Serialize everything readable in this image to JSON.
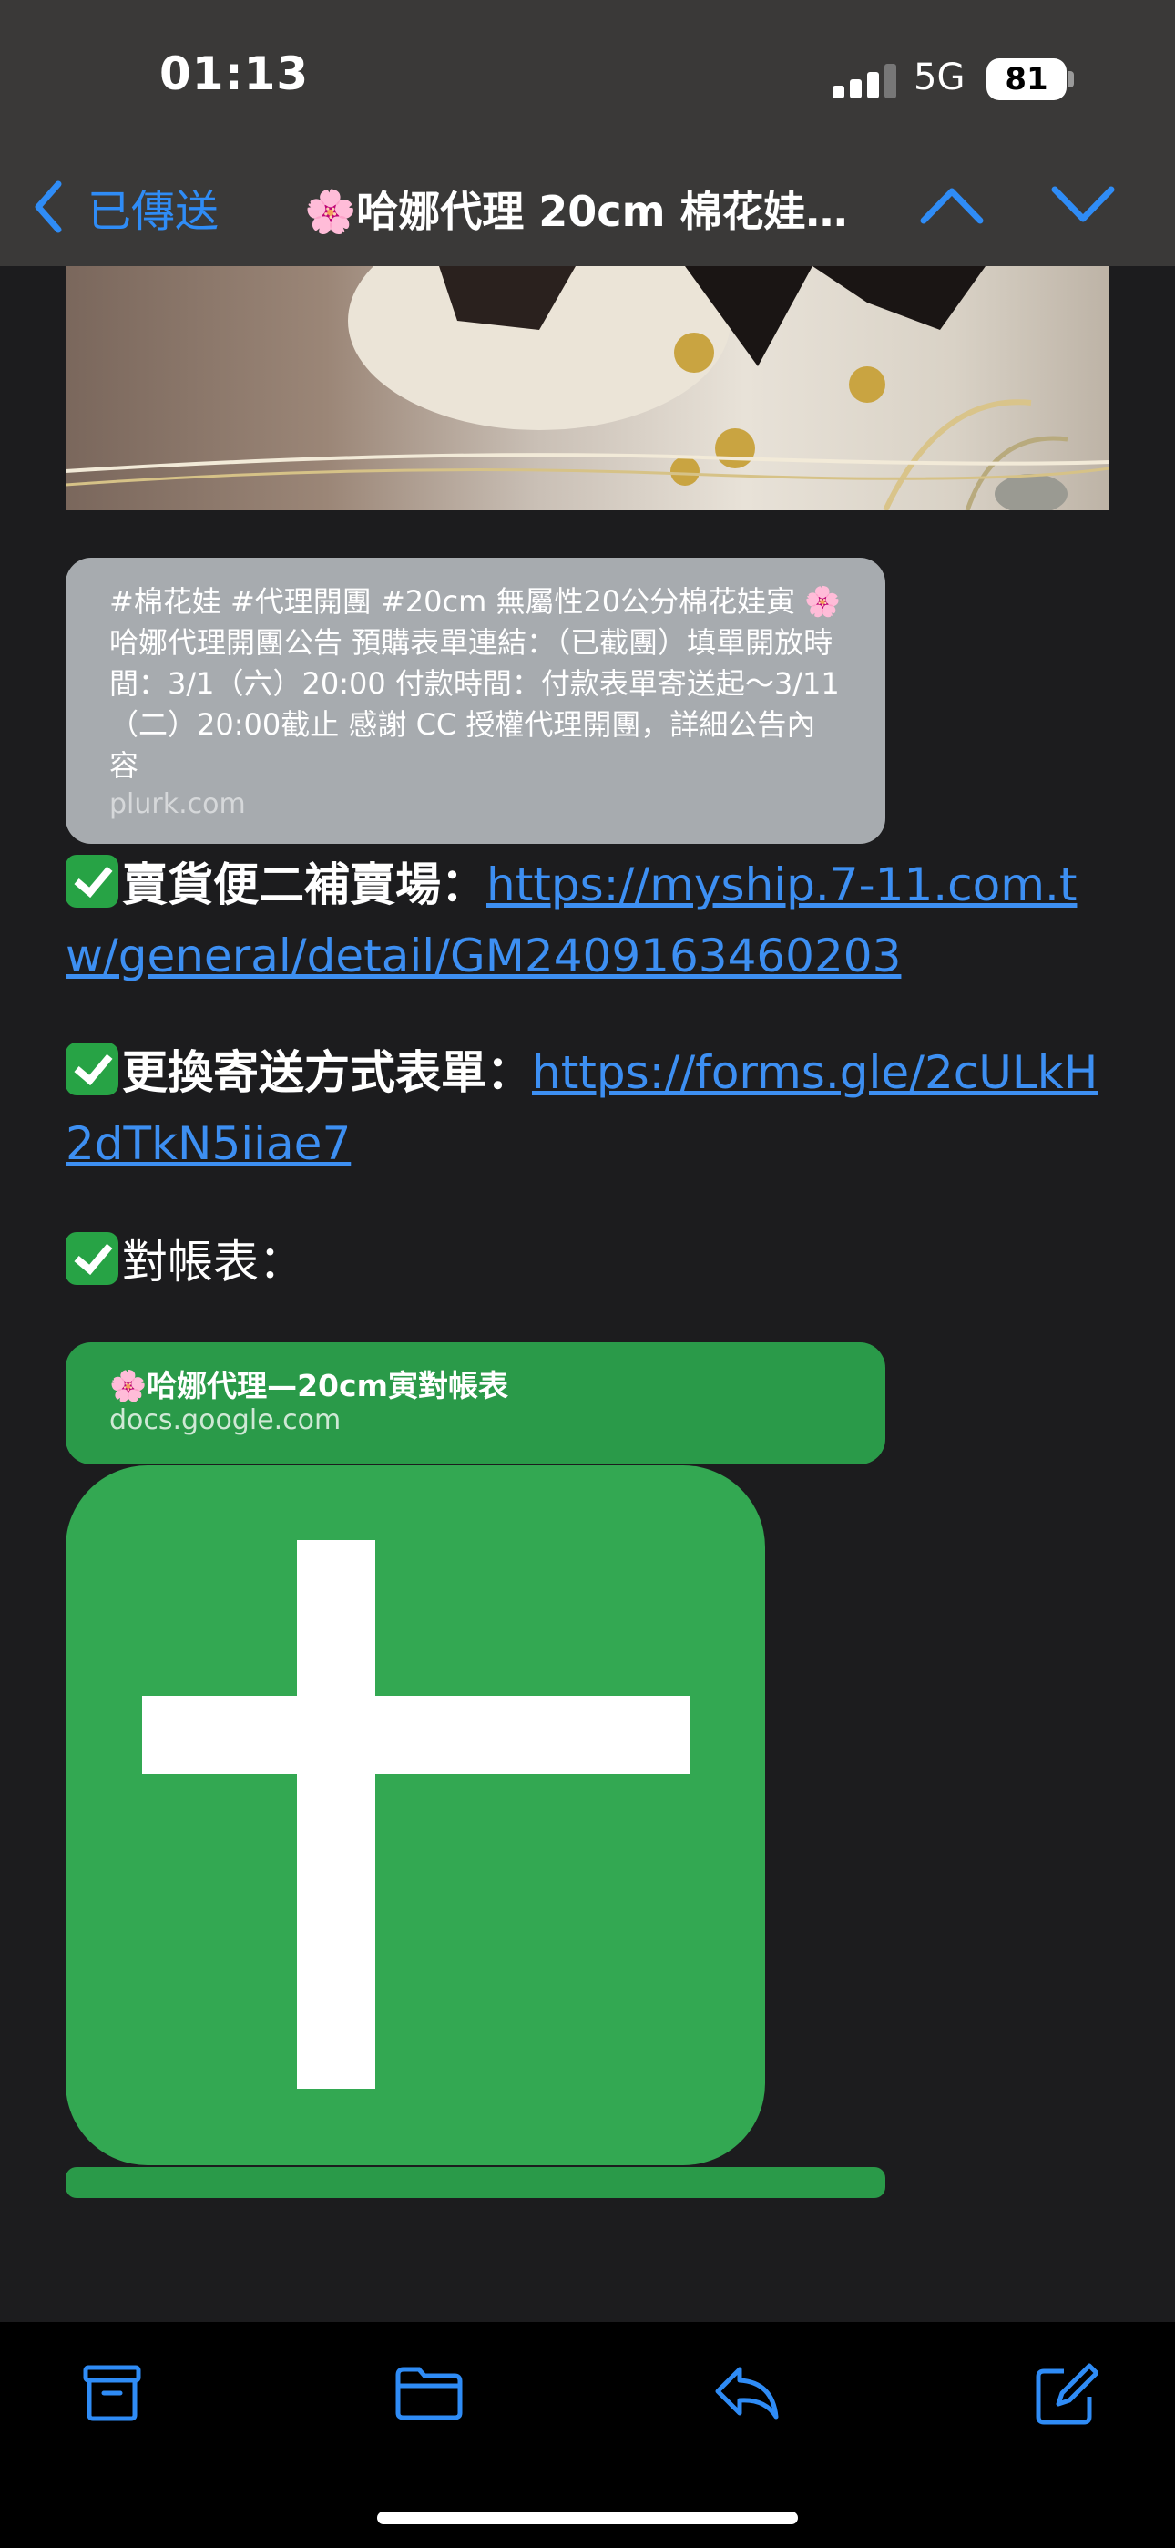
{
  "status_bar": {
    "time": "01:13",
    "network": "5G",
    "battery": "81"
  },
  "nav": {
    "back_label": "已傳送",
    "title": "🌸哈娜代理 20cm 棉花娃…",
    "icons": [
      "chevron-left-icon",
      "chevron-up-icon",
      "chevron-down-icon"
    ],
    "accent_color": "#2f8cf6"
  },
  "link_preview_plurk": {
    "text": "#棉花娃 #代理開團 #20cm 無屬性20公分棉花娃寅 🌸哈娜代理開團公告 預購表單連結：（已截團）填單開放時間：3/1（六）20:00 付款時間：付款表單寄送起～3/11（二）20:00截止 感謝 CC 授權代理開團，詳細公告內容",
    "domain": "plurk.com"
  },
  "messages": {
    "shop_label": "賣貨便二補賣場：",
    "shop_link": "https://myship.7-11.com.tw/general/detail/GM2409163460203",
    "form_label": "更換寄送方式表單：",
    "form_link": "https://forms.gle/2cULkH2dTkN5iiae7",
    "ledger_label": "對帳表："
  },
  "link_preview_docs": {
    "text": "🌸哈娜代理—20cm寅對帳表",
    "domain": "docs.google.com",
    "icon": "google-sheets-icon"
  },
  "toolbar": {
    "icons": [
      "archive-icon",
      "folder-icon",
      "reply-icon",
      "compose-icon"
    ]
  }
}
